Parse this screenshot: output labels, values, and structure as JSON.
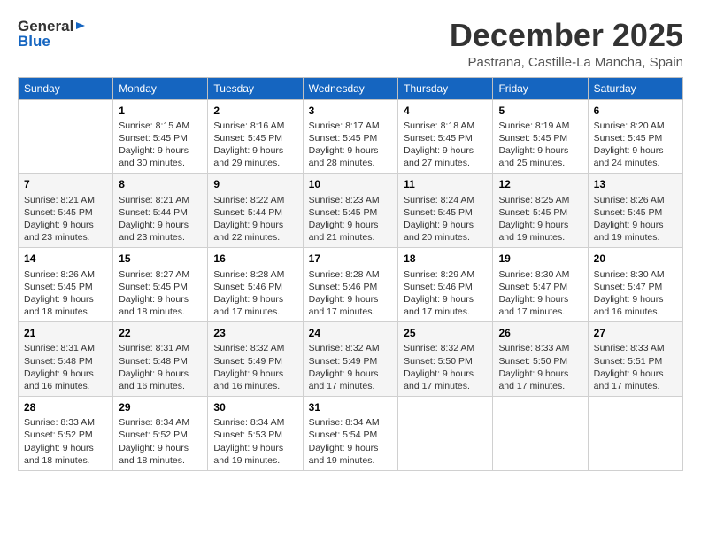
{
  "logo": {
    "general": "General",
    "blue": "Blue"
  },
  "header": {
    "title": "December 2025",
    "subtitle": "Pastrana, Castille-La Mancha, Spain"
  },
  "weekdays": [
    "Sunday",
    "Monday",
    "Tuesday",
    "Wednesday",
    "Thursday",
    "Friday",
    "Saturday"
  ],
  "weeks": [
    [
      {
        "day": "",
        "info": ""
      },
      {
        "day": "1",
        "info": "Sunrise: 8:15 AM\nSunset: 5:45 PM\nDaylight: 9 hours\nand 30 minutes."
      },
      {
        "day": "2",
        "info": "Sunrise: 8:16 AM\nSunset: 5:45 PM\nDaylight: 9 hours\nand 29 minutes."
      },
      {
        "day": "3",
        "info": "Sunrise: 8:17 AM\nSunset: 5:45 PM\nDaylight: 9 hours\nand 28 minutes."
      },
      {
        "day": "4",
        "info": "Sunrise: 8:18 AM\nSunset: 5:45 PM\nDaylight: 9 hours\nand 27 minutes."
      },
      {
        "day": "5",
        "info": "Sunrise: 8:19 AM\nSunset: 5:45 PM\nDaylight: 9 hours\nand 25 minutes."
      },
      {
        "day": "6",
        "info": "Sunrise: 8:20 AM\nSunset: 5:45 PM\nDaylight: 9 hours\nand 24 minutes."
      }
    ],
    [
      {
        "day": "7",
        "info": "Sunrise: 8:21 AM\nSunset: 5:45 PM\nDaylight: 9 hours\nand 23 minutes."
      },
      {
        "day": "8",
        "info": "Sunrise: 8:21 AM\nSunset: 5:44 PM\nDaylight: 9 hours\nand 23 minutes."
      },
      {
        "day": "9",
        "info": "Sunrise: 8:22 AM\nSunset: 5:44 PM\nDaylight: 9 hours\nand 22 minutes."
      },
      {
        "day": "10",
        "info": "Sunrise: 8:23 AM\nSunset: 5:45 PM\nDaylight: 9 hours\nand 21 minutes."
      },
      {
        "day": "11",
        "info": "Sunrise: 8:24 AM\nSunset: 5:45 PM\nDaylight: 9 hours\nand 20 minutes."
      },
      {
        "day": "12",
        "info": "Sunrise: 8:25 AM\nSunset: 5:45 PM\nDaylight: 9 hours\nand 19 minutes."
      },
      {
        "day": "13",
        "info": "Sunrise: 8:26 AM\nSunset: 5:45 PM\nDaylight: 9 hours\nand 19 minutes."
      }
    ],
    [
      {
        "day": "14",
        "info": "Sunrise: 8:26 AM\nSunset: 5:45 PM\nDaylight: 9 hours\nand 18 minutes."
      },
      {
        "day": "15",
        "info": "Sunrise: 8:27 AM\nSunset: 5:45 PM\nDaylight: 9 hours\nand 18 minutes."
      },
      {
        "day": "16",
        "info": "Sunrise: 8:28 AM\nSunset: 5:46 PM\nDaylight: 9 hours\nand 17 minutes."
      },
      {
        "day": "17",
        "info": "Sunrise: 8:28 AM\nSunset: 5:46 PM\nDaylight: 9 hours\nand 17 minutes."
      },
      {
        "day": "18",
        "info": "Sunrise: 8:29 AM\nSunset: 5:46 PM\nDaylight: 9 hours\nand 17 minutes."
      },
      {
        "day": "19",
        "info": "Sunrise: 8:30 AM\nSunset: 5:47 PM\nDaylight: 9 hours\nand 17 minutes."
      },
      {
        "day": "20",
        "info": "Sunrise: 8:30 AM\nSunset: 5:47 PM\nDaylight: 9 hours\nand 16 minutes."
      }
    ],
    [
      {
        "day": "21",
        "info": "Sunrise: 8:31 AM\nSunset: 5:48 PM\nDaylight: 9 hours\nand 16 minutes."
      },
      {
        "day": "22",
        "info": "Sunrise: 8:31 AM\nSunset: 5:48 PM\nDaylight: 9 hours\nand 16 minutes."
      },
      {
        "day": "23",
        "info": "Sunrise: 8:32 AM\nSunset: 5:49 PM\nDaylight: 9 hours\nand 16 minutes."
      },
      {
        "day": "24",
        "info": "Sunrise: 8:32 AM\nSunset: 5:49 PM\nDaylight: 9 hours\nand 17 minutes."
      },
      {
        "day": "25",
        "info": "Sunrise: 8:32 AM\nSunset: 5:50 PM\nDaylight: 9 hours\nand 17 minutes."
      },
      {
        "day": "26",
        "info": "Sunrise: 8:33 AM\nSunset: 5:50 PM\nDaylight: 9 hours\nand 17 minutes."
      },
      {
        "day": "27",
        "info": "Sunrise: 8:33 AM\nSunset: 5:51 PM\nDaylight: 9 hours\nand 17 minutes."
      }
    ],
    [
      {
        "day": "28",
        "info": "Sunrise: 8:33 AM\nSunset: 5:52 PM\nDaylight: 9 hours\nand 18 minutes."
      },
      {
        "day": "29",
        "info": "Sunrise: 8:34 AM\nSunset: 5:52 PM\nDaylight: 9 hours\nand 18 minutes."
      },
      {
        "day": "30",
        "info": "Sunrise: 8:34 AM\nSunset: 5:53 PM\nDaylight: 9 hours\nand 19 minutes."
      },
      {
        "day": "31",
        "info": "Sunrise: 8:34 AM\nSunset: 5:54 PM\nDaylight: 9 hours\nand 19 minutes."
      },
      {
        "day": "",
        "info": ""
      },
      {
        "day": "",
        "info": ""
      },
      {
        "day": "",
        "info": ""
      }
    ]
  ]
}
